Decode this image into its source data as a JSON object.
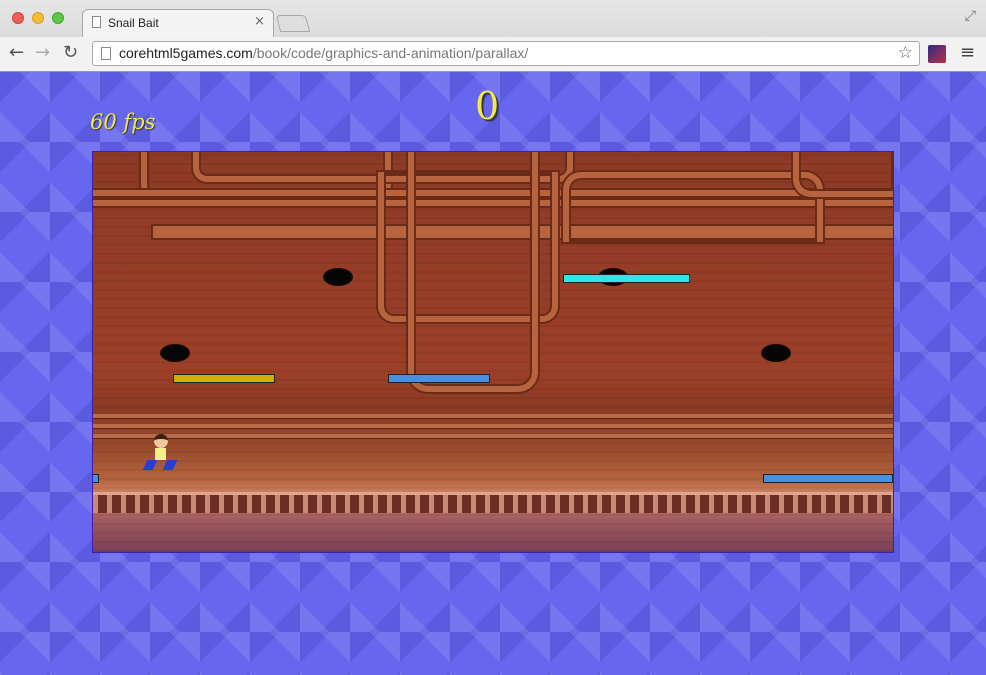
{
  "browser": {
    "tab_title": "Snail Bait",
    "tab_close": "×",
    "url_host": "corehtml5games.com",
    "url_path": "/book/code/graphics-and-animation/parallax/",
    "icons": {
      "back": "←",
      "forward": "→",
      "reload": "↻",
      "star": "☆",
      "menu": "≡",
      "fullscreen": "⤢"
    }
  },
  "game": {
    "fps_text": "60 fps",
    "score": "0",
    "colors": {
      "score": "#f2e84c",
      "background": "#6666ee",
      "platform_gold": "#c8b400",
      "platform_blue": "#4a90e2",
      "platform_cyan": "#2ee6e6"
    }
  }
}
